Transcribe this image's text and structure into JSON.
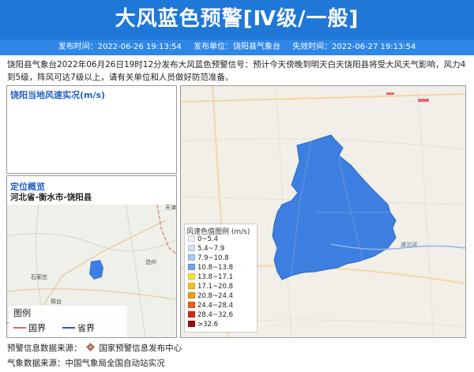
{
  "header": {
    "title": "大风蓝色预警[Ⅳ级/一般]",
    "publish_time": "发布时间：2022-06-26 19:13:54",
    "publisher": "发布单位：饶阳县气象台",
    "expire_time": "失效时间：2022-06-27 19:13:54"
  },
  "description": "饶阳县气象台2022年06月26日19时12分发布大风蓝色预警信号：预计今天傍晚到明天白天饶阳县将受大风天气影响，风力4到5级，阵风可达7级以上，请有关单位和人员做好防范准备。",
  "wind_panel": {
    "title": "饶阳当地风速实况(m/s)"
  },
  "location_panel": {
    "title": "定位概览",
    "path": "河北省-衡水市-饶阳县",
    "places": [
      "天津",
      "石家庄",
      "邢台",
      "沧州"
    ]
  },
  "map": {
    "river_label": "滹沱河",
    "legend": {
      "title": "风速色值图例 (m/s)",
      "items": [
        {
          "label": "0~5.4",
          "color": "#f0f0f0"
        },
        {
          "label": "5.4~7.9",
          "color": "#cfe0f7"
        },
        {
          "label": "7.9~10.8",
          "color": "#a6c8f2"
        },
        {
          "label": "10.8~13.8",
          "color": "#6fa6ea"
        },
        {
          "label": "13.8~17.1",
          "color": "#f5e23a"
        },
        {
          "label": "17.1~20.8",
          "color": "#f2c21b"
        },
        {
          "label": "20.8~24.4",
          "color": "#f29a1d"
        },
        {
          "label": "24.4~28.4",
          "color": "#e8601a"
        },
        {
          "label": "28.4~32.6",
          "color": "#d52a12"
        },
        {
          "label": ">32.6",
          "color": "#9b0d0d"
        }
      ]
    }
  },
  "mini_legend": {
    "title": "图例",
    "country_border": "国界",
    "province_border": "省界"
  },
  "footer": {
    "source_warning": "预警信息数据来源：",
    "source_warning_name": "国家预警信息发布中心",
    "source_weather": "气象数据来源：中国气象局全国自动站实况"
  },
  "colors": {
    "header_blue": "#1f77d8",
    "subbar_blue": "#2e86e6",
    "county_fill": "#3d7fe0",
    "panel_title": "#1f5fc8"
  }
}
